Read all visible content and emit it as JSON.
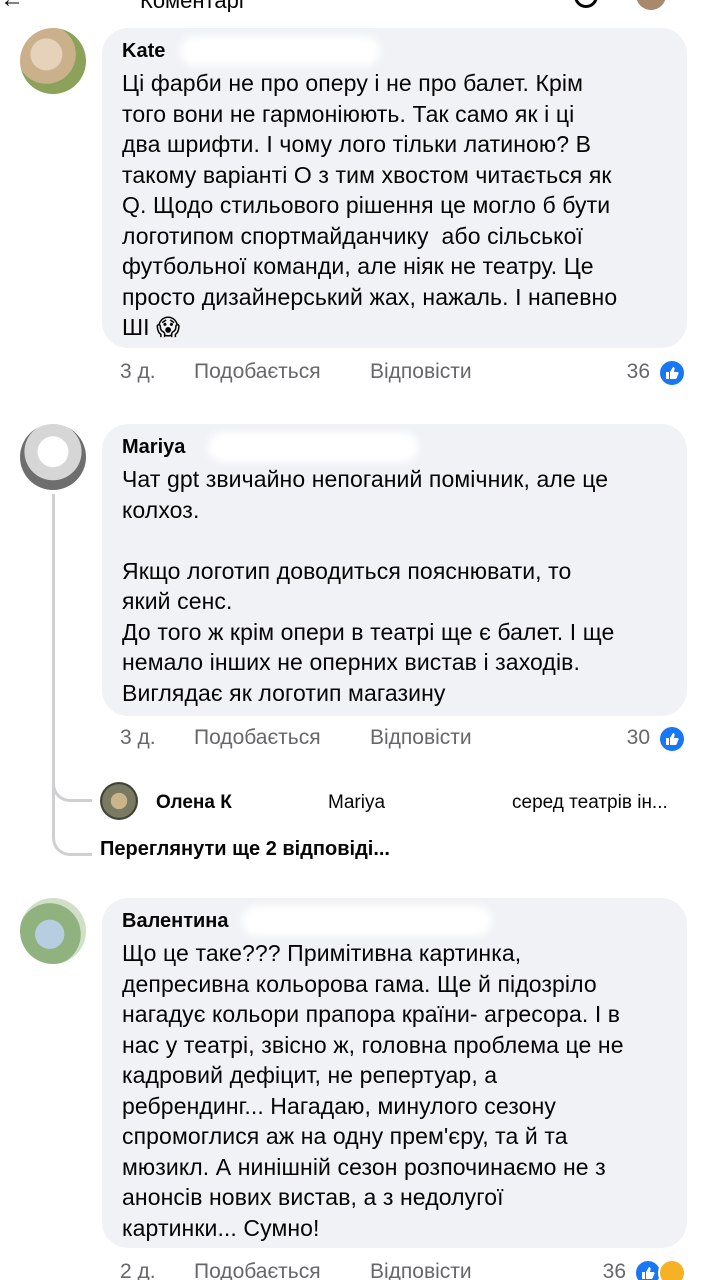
{
  "header": {
    "title": "Коментарі",
    "back_icon": "back-arrow-icon",
    "search_icon": "search-icon"
  },
  "comments": [
    {
      "author": "Kate",
      "text": "Ці фарби не про оперу і не про балет. Крім\nтого вони не гармоніюють. Так само як і ці\nдва шрифти. І чому лого тільки латиною? В\nтакому варіанті О з тим хвостом читається як\nQ. Щодо стильового рішення це могло б бути\nлоготипом спортмайданчику  або сільської\nфутбольної команди, але ніяк не театру. Це\nпросто дизайнерський жах, нажаль. І напевно\nШІ 😱",
      "time": "3 д.",
      "like_label": "Подобається",
      "reply_label": "Відповісти",
      "reaction_count": "36"
    },
    {
      "author": "Mariya",
      "text": "Чат gpt звичайно непоганий помічник, але це\nколхоз.\n\nЯкщо логотип доводиться пояснювати, то\nякий сенс.\nДо того ж крім опери в театрі ще є балет. І ще\nнемало інших не оперних вистав і заходів.\nВиглядає як логотип магазину",
      "time": "3 д.",
      "like_label": "Подобається",
      "reply_label": "Відповісти",
      "reaction_count": "30"
    },
    {
      "author": "Валентина",
      "text": "Що це таке??? Примітивна картинка,\nдепресивна кольорова гама. Ще й підозріло\nнагадує кольори прапора країни- агресора. І в\nнас у театрі, звісно ж, головна проблема це не\nкадровий дефіцит, не репертуар, а\nребрендинг... Нагадаю, минулого сезону\nспромоглися аж на одну прем'єру, та й та\nмюзикл. А нинішній сезон розпочинаємо не з\nанонсів нових вистав, а з недолугої\nкартинки... Сумно!",
      "time": "2 д.",
      "like_label": "Подобається",
      "reply_label": "Відповісти",
      "reaction_count": "36"
    }
  ],
  "reply_preview": {
    "author": "Олена К",
    "mention": "Mariya",
    "text": "серед театрів ін..."
  },
  "more_replies_label": "Переглянути ще 2 відповіді...",
  "colors": {
    "bubble": "#f0f2f5",
    "meta": "#65676b",
    "like": "#1877f2",
    "thread": "#ced0d4"
  }
}
